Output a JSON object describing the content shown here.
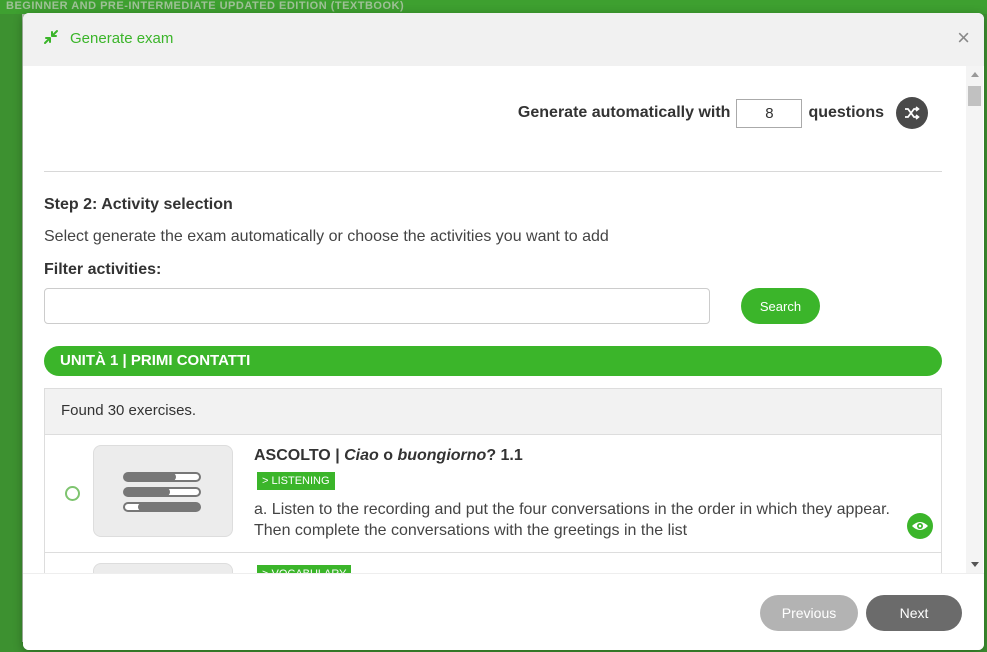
{
  "background": {
    "header_text": "BEGINNER AND PRE-INTERMEDIATE UPDATED EDITION (TEXTBOOK)"
  },
  "modal": {
    "title": "Generate exam",
    "close_glyph": "×",
    "icon": "compress-arrows-icon"
  },
  "generate": {
    "label_before": "Generate automatically with",
    "question_count": "8",
    "label_after": "questions",
    "shuffle_icon": "shuffle-icon"
  },
  "step": {
    "title": "Step 2: Activity selection",
    "description": "Select generate the exam automatically or choose the activities you want to add",
    "filter_label": "Filter activities:",
    "filter_value": "",
    "search_label": "Search"
  },
  "unit": {
    "title": "UNITÀ 1 | PRIMI CONTATTI"
  },
  "results": {
    "found_text": "Found 30 exercises.",
    "exercises": [
      {
        "title_prefix": "ASCOLTO | ",
        "title_italic_1": "Ciao",
        "title_mid": " o ",
        "title_italic_2": "buongiorno",
        "title_suffix": "? 1.1",
        "tag": "> LISTENING",
        "description": "a. Listen to the recording and put the four conversations in the order in which they appear. Then complete the conversations with the greetings in the list",
        "thumb_icon": "sliders-icon",
        "preview_icon": "eye-icon"
      },
      {
        "tag": "> VOCABULARY"
      }
    ]
  },
  "footer": {
    "previous_label": "Previous",
    "next_label": "Next"
  },
  "colors": {
    "accent": "#3bb52a",
    "dark_button": "#6b6b6b",
    "disabled_button": "#b3b3b3"
  }
}
